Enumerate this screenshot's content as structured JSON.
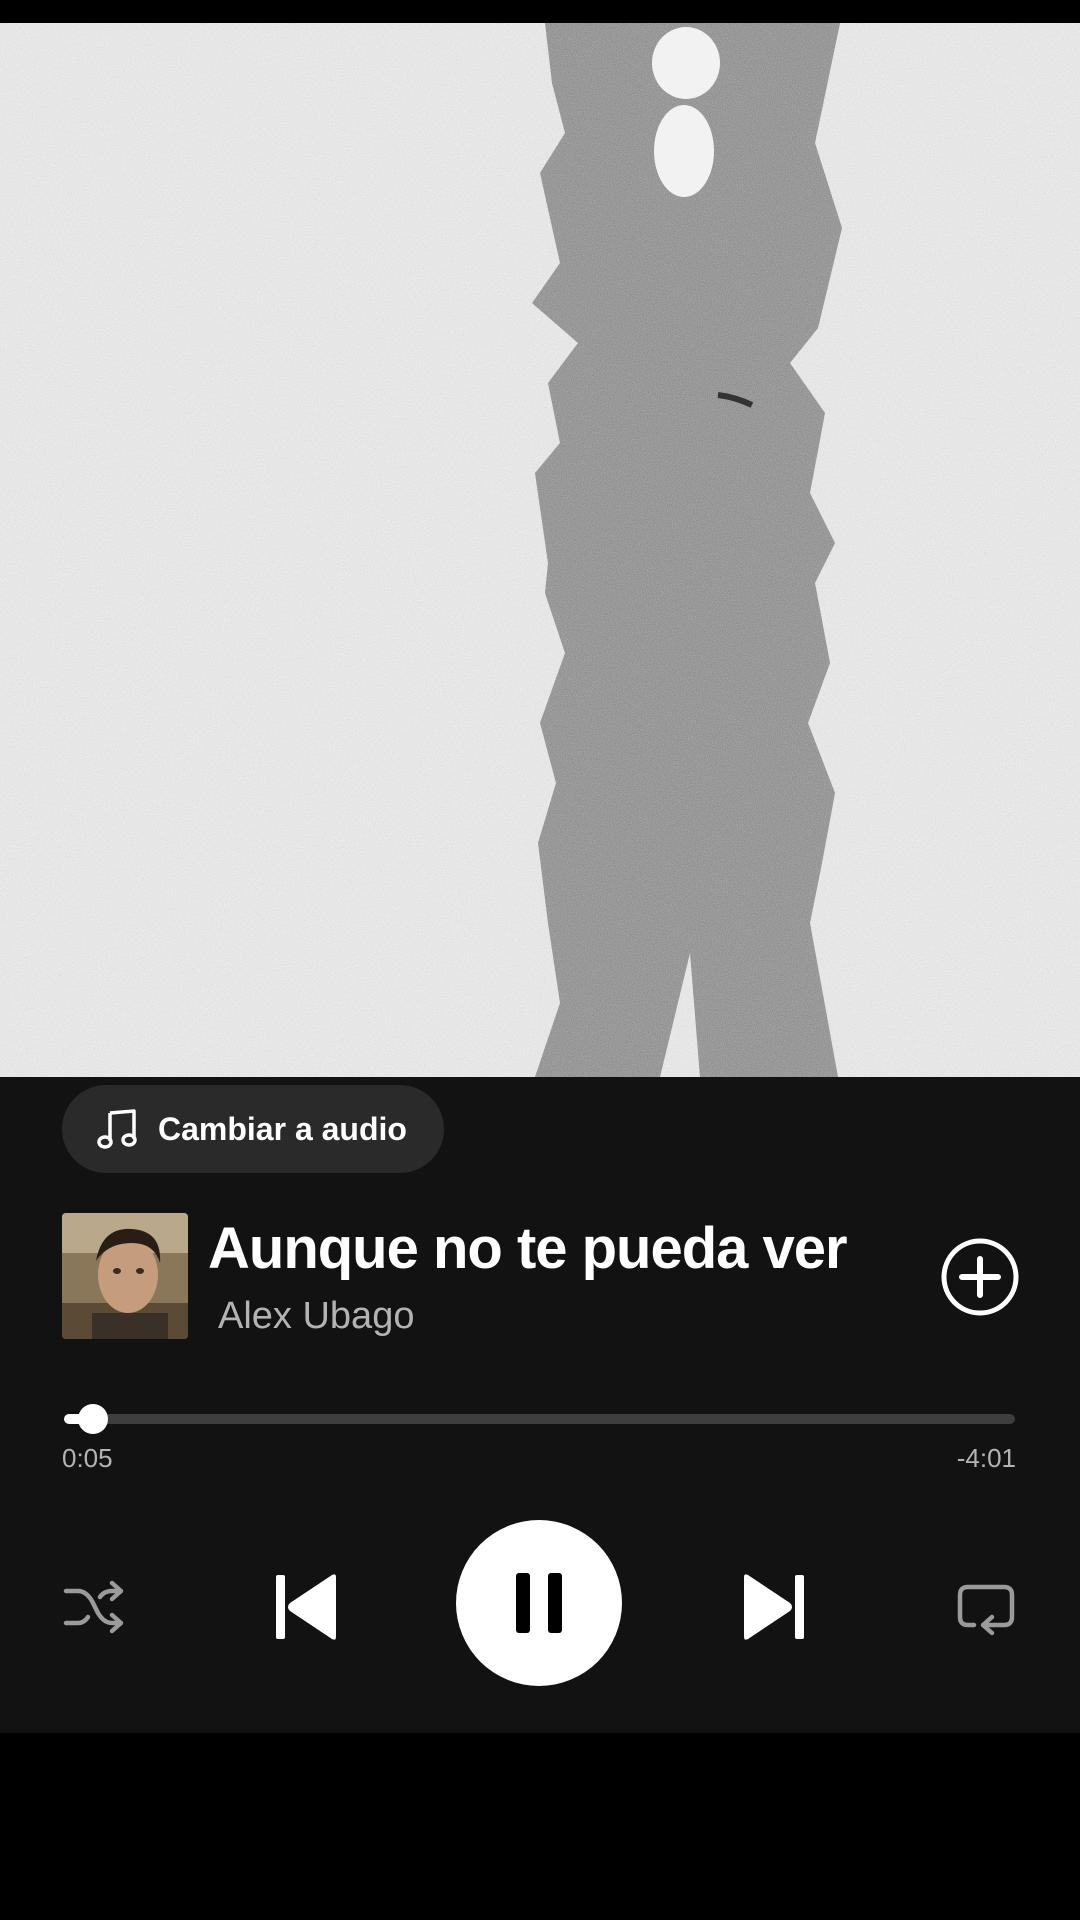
{
  "switch_audio": {
    "label": "Cambiar a audio",
    "icon": "music-note-icon"
  },
  "track": {
    "title": "Aunque no te pueda ver",
    "artist": "Alex Ubago",
    "artwork_icon": "album-artwork"
  },
  "add_button": {
    "icon": "plus-circle-icon"
  },
  "progress": {
    "elapsed": "0:05",
    "remaining": "-4:01",
    "fraction": 0.03
  },
  "controls": {
    "shuffle_icon": "shuffle-icon",
    "previous_icon": "skip-previous-icon",
    "pause_icon": "pause-icon",
    "next_icon": "skip-next-icon",
    "repeat_icon": "repeat-icon"
  },
  "colors": {
    "panel_background": "#121212",
    "text_primary": "#ffffff",
    "text_secondary": "#b3b3b3",
    "track_background": "#3e3e3e",
    "inactive_icon": "#9a9a9a"
  }
}
